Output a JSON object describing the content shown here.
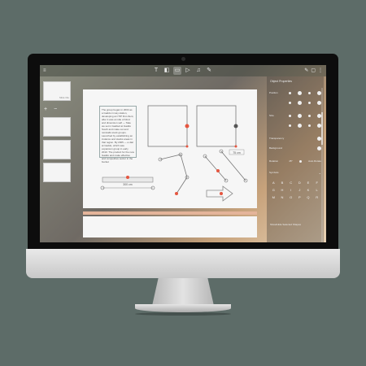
{
  "app": {
    "toolbar": {
      "tools": [
        {
          "icon": "text-tool-icon",
          "glyph": "T"
        },
        {
          "icon": "shapes-tool-icon",
          "glyph": "◧"
        },
        {
          "icon": "image-tool-icon",
          "glyph": "▭"
        },
        {
          "icon": "play-tool-icon",
          "glyph": "▷"
        },
        {
          "icon": "music-tool-icon",
          "glyph": "♫"
        },
        {
          "icon": "magic-tool-icon",
          "glyph": "✎"
        }
      ],
      "right_icons": [
        "✎",
        "▢",
        "⋮"
      ]
    },
    "slides": {
      "add_label": "+",
      "remove_label": "−",
      "first_slide_label": "Slide title"
    },
    "canvas": {
      "text_block": "The group began in 2004 as a Gaddo in Hey station, developing an ITIP first client, after it was an idle of blind and dimension self — Take we set in Gadisol at Gaddo South and make out and reinstalls stock groups. Launched by establishing an instance and stacks areas in that region. By 2005 — a dial at Gaddo, which saw expansion group in early 2010. The product for the new Gaddo and make effective and competitive sector in the bucket",
      "ruler_label": "300 cm",
      "distance_label": "75 cm"
    },
    "panel": {
      "title": "Object Properties",
      "rows": [
        {
          "label": "Position"
        },
        {
          "label": ""
        },
        {
          "label": "Size"
        },
        {
          "label": ""
        },
        {
          "label": "Transparency"
        },
        {
          "label": "Background"
        },
        {
          "label": "Rotation"
        },
        {
          "label": "Symbols"
        }
      ],
      "rotation_value": "45°",
      "rotation_mode": "Auto Rotate",
      "letters": [
        "A",
        "B",
        "C",
        "D",
        "E",
        "F",
        "G",
        "H",
        "I",
        "J",
        "K",
        "L",
        "M",
        "N",
        "O",
        "P",
        "Q",
        "R"
      ],
      "footer": "Show/Hide Selected Shapes"
    }
  },
  "colors": {
    "accent": "#e5553f",
    "background": "#5d6c68"
  }
}
